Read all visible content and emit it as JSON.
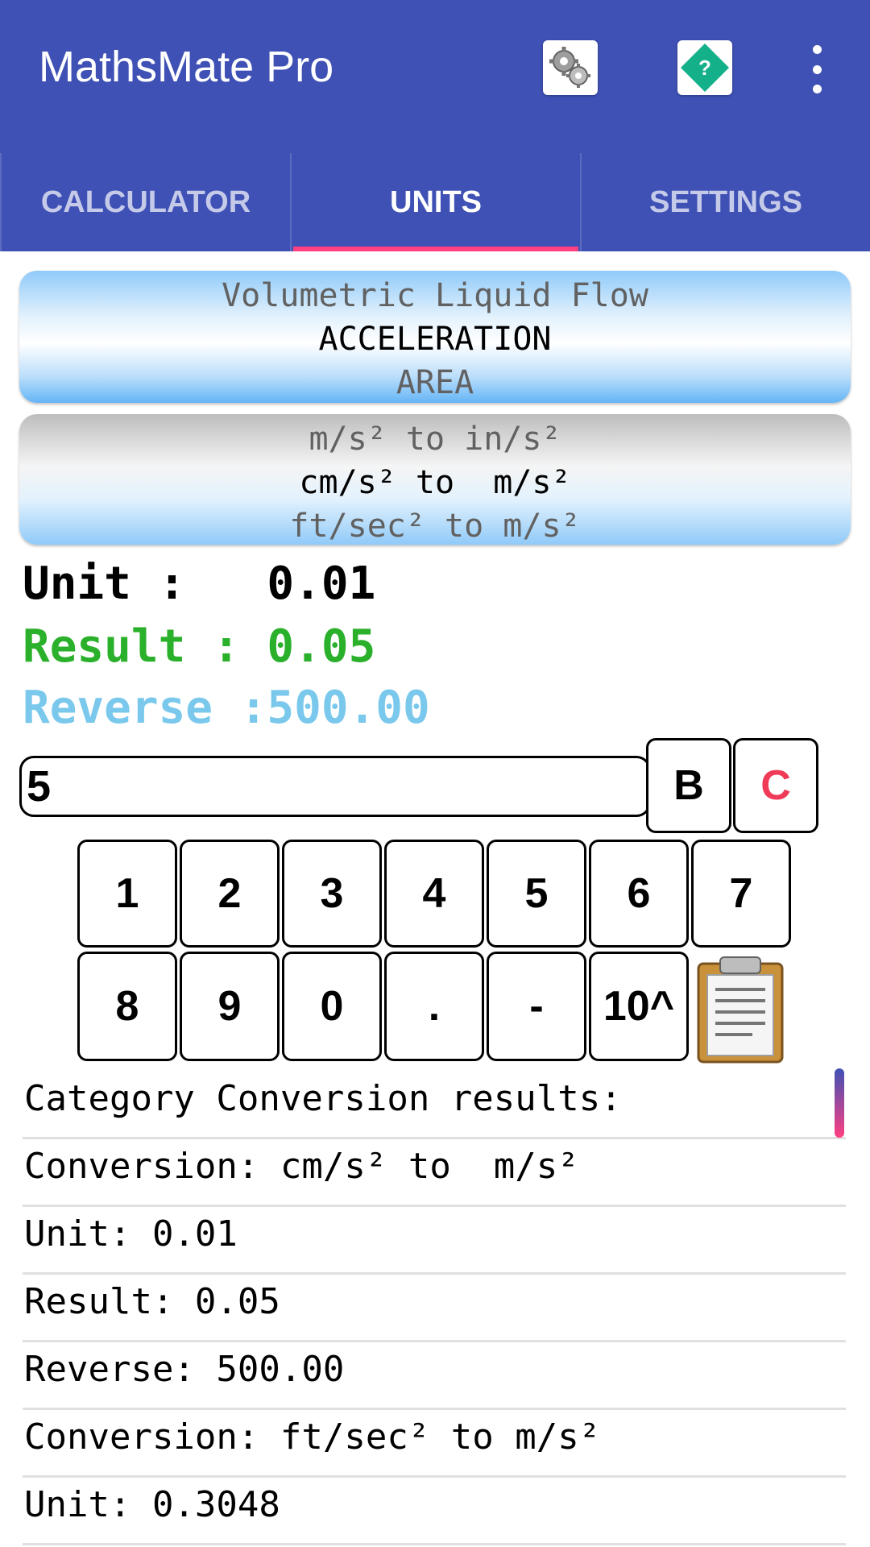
{
  "app": {
    "title": "MathsMate Pro",
    "menu_icons": [
      "gears-icon",
      "help-diamond-icon",
      "more-vert-icon"
    ],
    "help_glyph": "?"
  },
  "tabs": [
    {
      "label": "CALCULATOR",
      "active": false
    },
    {
      "label": "UNITS",
      "active": true
    },
    {
      "label": "SETTINGS",
      "active": false
    }
  ],
  "category_picker": {
    "prev": "Volumetric Liquid Flow",
    "selected": "ACCELERATION",
    "next": "AREA"
  },
  "conversion_picker": {
    "prev": "m/s² to in/s²",
    "selected": "cm/s² to  m/s²",
    "next": "ft/sec² to m/s²"
  },
  "readout": {
    "unit": "Unit :   0.01",
    "result": "Result : 0.05",
    "reverse": "Reverse :500.00"
  },
  "input": {
    "value": "5",
    "backspace_label": "B",
    "clear_label": "C"
  },
  "keypad": {
    "row1": [
      "1",
      "2",
      "3",
      "4",
      "5",
      "6",
      "7"
    ],
    "row2": [
      "8",
      "9",
      "0",
      ".",
      "-",
      "10^"
    ]
  },
  "results_list": [
    "Category Conversion results:",
    "Conversion: cm/s² to  m/s²",
    "Unit: 0.01",
    "Result: 0.05",
    "Reverse: 500.00",
    "Conversion: ft/sec² to m/s²",
    "Unit: 0.3048"
  ],
  "colors": {
    "primary": "#3f51b5",
    "accent": "#ff4081",
    "result_green": "#2ab02a",
    "reverse_blue": "#7ac8ec",
    "clear_red": "#ef3b58"
  }
}
